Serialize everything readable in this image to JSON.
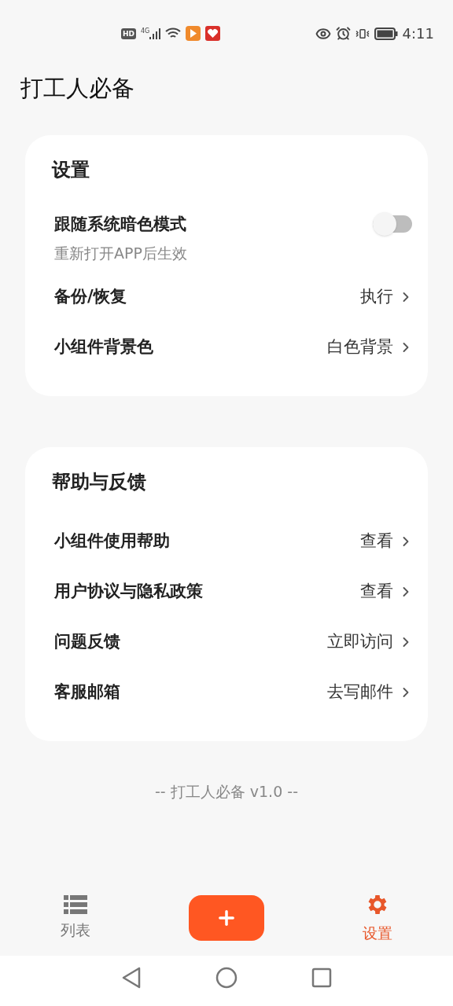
{
  "status_bar": {
    "hd": "HD",
    "network": "4G",
    "time": "4:11"
  },
  "app_title": "打工人必备",
  "sections": [
    {
      "title": "设置",
      "rows": [
        {
          "kind": "toggle",
          "label": "跟随系统暗色模式",
          "subtitle": "重新打开APP后生效",
          "on": false
        },
        {
          "kind": "link",
          "label": "备份/恢复",
          "value": "执行"
        },
        {
          "kind": "link",
          "label": "小组件背景色",
          "value": "白色背景"
        }
      ]
    },
    {
      "title": "帮助与反馈",
      "rows": [
        {
          "kind": "link",
          "label": "小组件使用帮助",
          "value": "查看"
        },
        {
          "kind": "link",
          "label": "用户协议与隐私政策",
          "value": "查看"
        },
        {
          "kind": "link",
          "label": "问题反馈",
          "value": "立即访问"
        },
        {
          "kind": "link",
          "label": "客服邮箱",
          "value": "去写邮件"
        }
      ]
    }
  ],
  "footer": "-- 打工人必备 v1.0 --",
  "bottom_nav": [
    {
      "kind": "list",
      "label": "列表",
      "selected": false
    },
    {
      "kind": "add"
    },
    {
      "kind": "settings",
      "label": "设置",
      "selected": true
    }
  ]
}
